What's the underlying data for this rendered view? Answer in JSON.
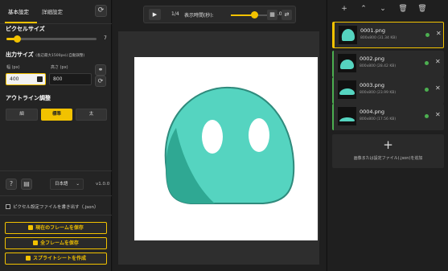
{
  "tabs": {
    "basic": "基本設定",
    "detail": "詳細設定"
  },
  "pixel_size": {
    "title": "ピクセルサイズ",
    "value": "7",
    "level": 0.12
  },
  "output_size": {
    "title": "出力サイズ",
    "subtitle": "(長辺最大1500pxに自動調整)",
    "width_label": "幅 (px)",
    "height_label": "高さ (px)",
    "width_value": "400",
    "height_value": "800"
  },
  "outline": {
    "title": "アウトライン調整",
    "options": [
      "細",
      "標準",
      "太"
    ],
    "selected": "標準"
  },
  "language": "日本語",
  "version": "v1.0.0",
  "export_settings_label": "ピクセル設定ファイルを書き出す（.json）",
  "actions": {
    "save_current": "現在のフレームを保存",
    "save_all": "全フレームを保存",
    "sprite_sheet": "スプライトシートを作成"
  },
  "toolbar": {
    "frame_counter": "1/4",
    "duration_label": "表示時間(秒):",
    "duration_value": "1.0 s",
    "duration_level": 0.55
  },
  "frames": [
    {
      "name": "0001.png",
      "meta": "800x800 (31.34 KB)",
      "status": "ok"
    },
    {
      "name": "0002.png",
      "meta": "800x800 (28.42 KB)",
      "status": "ok"
    },
    {
      "name": "0003.png",
      "meta": "800x800 (23.99 KB)",
      "status": "ok"
    },
    {
      "name": "0004.png",
      "meta": "800x800 (17.56 KB)",
      "status": "ok"
    }
  ],
  "add_frame_label": "画像または設定ファイル(.json)を追加",
  "colors": {
    "accent": "#f2c200",
    "status_ok": "#4caf50",
    "slime_main": "#55d4c0",
    "slime_shadow": "#2fa893"
  },
  "icons": [
    "refresh-icon",
    "play-icon",
    "grid-icon",
    "swap-icon",
    "plus-icon",
    "chevron-up-icon",
    "chevron-down-icon",
    "trash-icon",
    "trash-all-icon",
    "close-icon",
    "help-icon",
    "document-icon",
    "download-icon",
    "cloud-upload-icon",
    "sprite-grid-icon",
    "link-icon"
  ]
}
